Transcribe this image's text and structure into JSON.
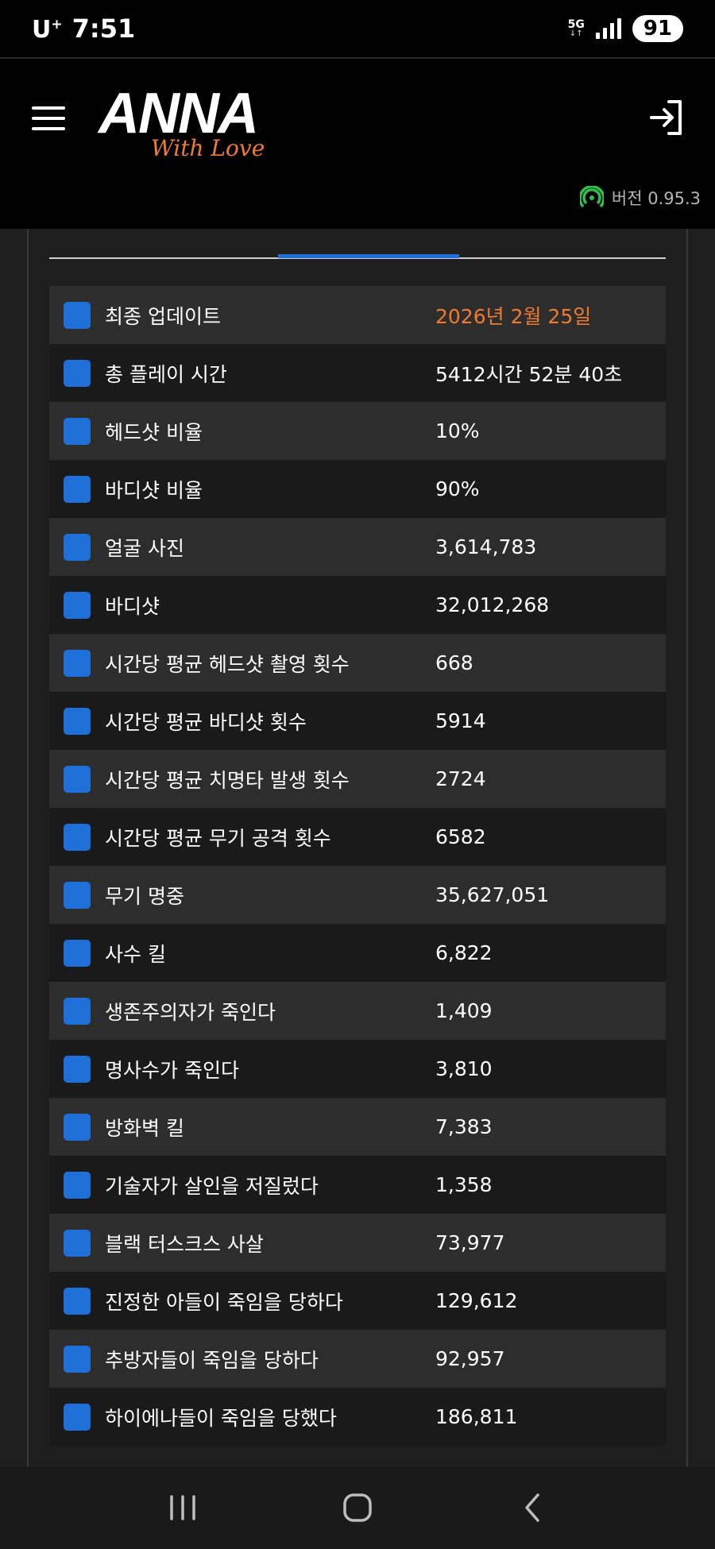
{
  "status_bar": {
    "carrier": "U",
    "carrier_sup": "+",
    "time": "7:51",
    "network": "5G",
    "battery": "91"
  },
  "header": {
    "logo_main": "ANNA",
    "logo_sub": "With Love",
    "version_text": "버전 0.95.3"
  },
  "colors": {
    "accent": "#f07b2f",
    "checkbox": "#1f6fd8",
    "row_odd": "#2d2d2d",
    "row_even": "#1a1a1a"
  },
  "stats": [
    {
      "label": "최종 업데이트",
      "value": "2026년 2월 25일",
      "accent": true
    },
    {
      "label": "총 플레이 시간",
      "value": "5412시간 52분 40초"
    },
    {
      "label": "헤드샷 비율",
      "value": "10%"
    },
    {
      "label": "바디샷 비율",
      "value": "90%"
    },
    {
      "label": "얼굴 사진",
      "value": "3,614,783"
    },
    {
      "label": "바디샷",
      "value": "32,012,268"
    },
    {
      "label": "시간당 평균 헤드샷 촬영 횟수",
      "value": "668"
    },
    {
      "label": "시간당 평균 바디샷 횟수",
      "value": "5914"
    },
    {
      "label": "시간당 평균 치명타 발생 횟수",
      "value": "2724"
    },
    {
      "label": "시간당 평균 무기 공격 횟수",
      "value": "6582"
    },
    {
      "label": "무기 명중",
      "value": "35,627,051"
    },
    {
      "label": "사수 킬",
      "value": "6,822"
    },
    {
      "label": "생존주의자가 죽인다",
      "value": "1,409"
    },
    {
      "label": "명사수가 죽인다",
      "value": "3,810"
    },
    {
      "label": "방화벽 킬",
      "value": "7,383"
    },
    {
      "label": "기술자가 살인을 저질렀다",
      "value": "1,358"
    },
    {
      "label": "블랙 터스크스 사살",
      "value": "73,977"
    },
    {
      "label": "진정한 아들이 죽임을 당하다",
      "value": "129,612"
    },
    {
      "label": "추방자들이 죽임을 당하다",
      "value": "92,957"
    },
    {
      "label": "하이에나들이 죽임을 당했다",
      "value": "186,811"
    }
  ]
}
